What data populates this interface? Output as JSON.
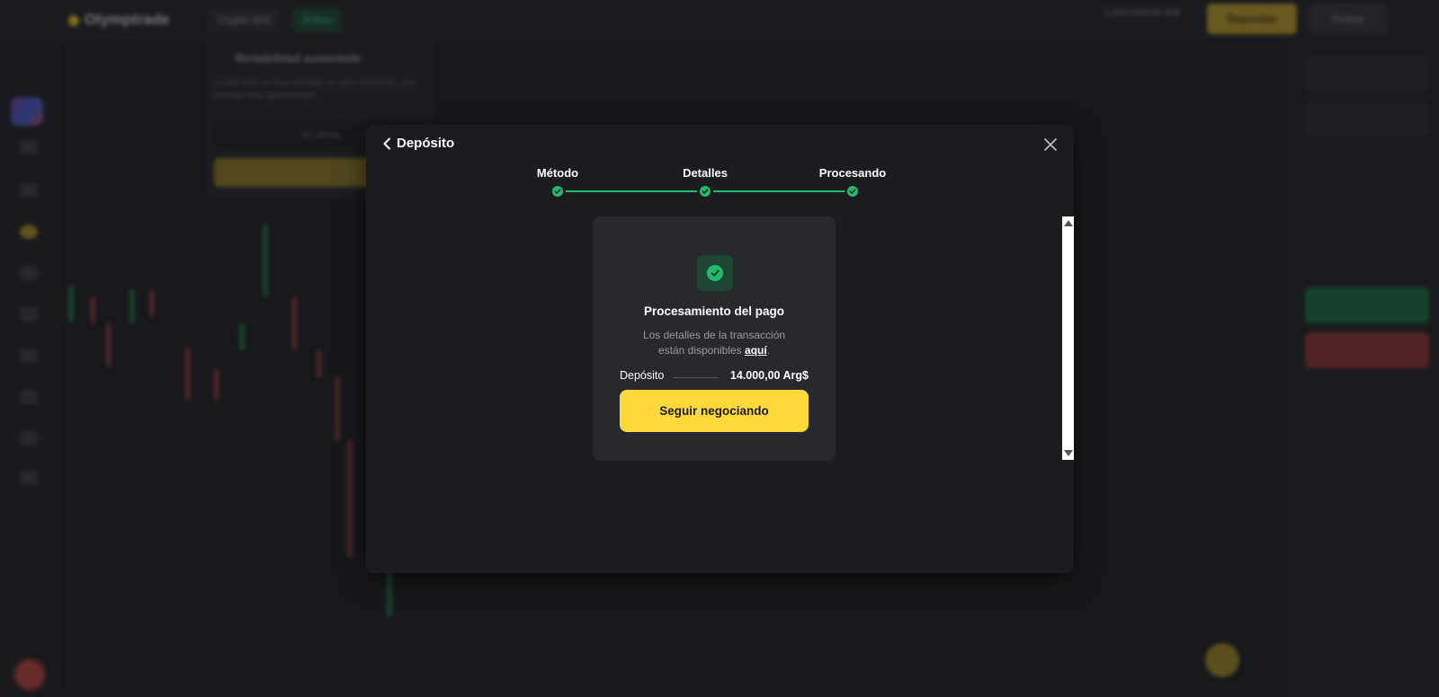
{
  "background": {
    "brand": "Olymptrade",
    "tabs": [
      "Crypto IDX",
      "Activo"
    ],
    "balance": "1.000.000,00 Ar$",
    "deposit_button": "Depositar",
    "withdraw_button": "Retirar",
    "popup_title": "Rentabilidad aumentada",
    "popup_text": "Crypto IDX es muy rentable en este momento, ¡no pierdas esta oportunidad!",
    "popup_button": "Ver ahora"
  },
  "modal": {
    "title": "Depósito",
    "steps": [
      {
        "label": "Método"
      },
      {
        "label": "Detalles"
      },
      {
        "label": "Procesando"
      }
    ],
    "card": {
      "title": "Procesamiento del pago",
      "desc_line1": "Los detalles de la transacción",
      "desc_line2": "están disponibles",
      "link": "aquí",
      "link_suffix": ".",
      "amount_label": "Depósito",
      "amount_value": "14.000,00 Arg$",
      "button": "Seguir negociando"
    }
  },
  "colors": {
    "accent_yellow": "#ffd83a",
    "success_green": "#25b86f",
    "modal_bg": "#1b1c20",
    "card_bg": "#27292e"
  },
  "icons": {
    "back": "chevron-left-icon",
    "close": "close-icon",
    "status": "check-circle-icon"
  }
}
